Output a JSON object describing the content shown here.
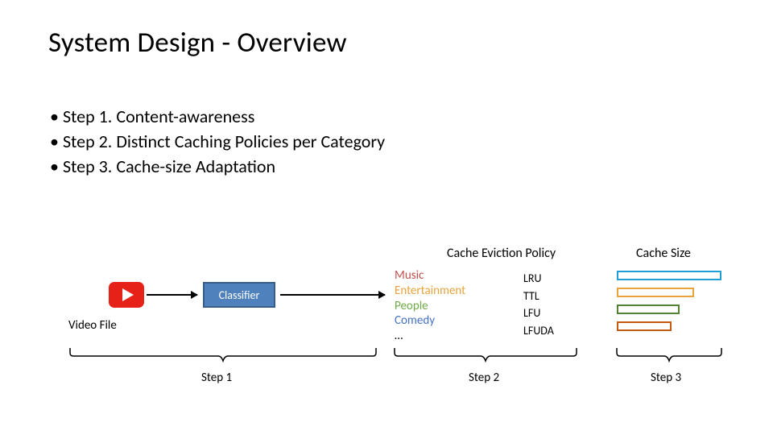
{
  "title": "System Design - Overview",
  "bullets": {
    "b1": "Step 1. Content-awareness",
    "b2": "Step 2. Distinct Caching Policies per Category",
    "b3": "Step 3. Cache-size Adaptation"
  },
  "video_file_label": "Video File",
  "classifier_label": "Classifier",
  "headers": {
    "policy": "Cache Eviction Policy",
    "size": "Cache Size"
  },
  "categories": {
    "music": "Music",
    "ent": "Entertainment",
    "people": "People",
    "comedy": "Comedy",
    "more": "…"
  },
  "policies": {
    "p1": "LRU",
    "p2": "TTL",
    "p3": "LFU",
    "p4": "LFUDA"
  },
  "steps": {
    "s1": "Step 1",
    "s2": "Step 2",
    "s3": "Step 3"
  }
}
